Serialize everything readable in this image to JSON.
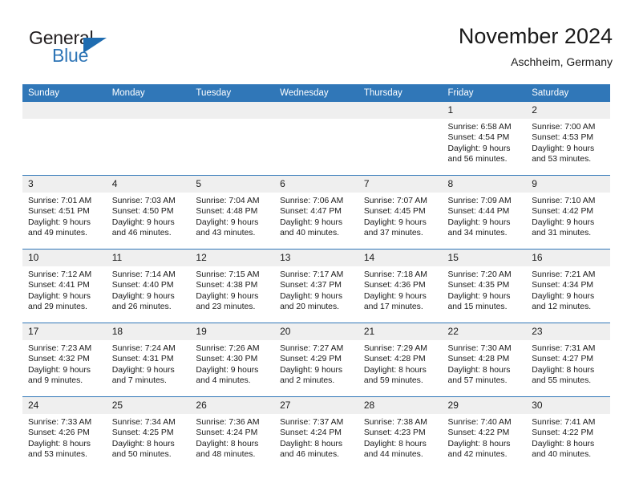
{
  "brand": {
    "name_part1": "General",
    "name_part2": "Blue",
    "flag_icon": "triangle-flag-icon"
  },
  "header": {
    "title": "November 2024",
    "location": "Aschheim, Germany"
  },
  "colors": {
    "header_blue": "#3077b8",
    "brand_blue": "#2e75b6",
    "daynum_band": "#efefef",
    "text": "#1a1a1a"
  },
  "calendar": {
    "weekdays": [
      "Sunday",
      "Monday",
      "Tuesday",
      "Wednesday",
      "Thursday",
      "Friday",
      "Saturday"
    ],
    "weeks": [
      [
        {
          "day": "",
          "sunrise": "",
          "sunset": "",
          "daylight1": "",
          "daylight2": ""
        },
        {
          "day": "",
          "sunrise": "",
          "sunset": "",
          "daylight1": "",
          "daylight2": ""
        },
        {
          "day": "",
          "sunrise": "",
          "sunset": "",
          "daylight1": "",
          "daylight2": ""
        },
        {
          "day": "",
          "sunrise": "",
          "sunset": "",
          "daylight1": "",
          "daylight2": ""
        },
        {
          "day": "",
          "sunrise": "",
          "sunset": "",
          "daylight1": "",
          "daylight2": ""
        },
        {
          "day": "1",
          "sunrise": "Sunrise: 6:58 AM",
          "sunset": "Sunset: 4:54 PM",
          "daylight1": "Daylight: 9 hours",
          "daylight2": "and 56 minutes."
        },
        {
          "day": "2",
          "sunrise": "Sunrise: 7:00 AM",
          "sunset": "Sunset: 4:53 PM",
          "daylight1": "Daylight: 9 hours",
          "daylight2": "and 53 minutes."
        }
      ],
      [
        {
          "day": "3",
          "sunrise": "Sunrise: 7:01 AM",
          "sunset": "Sunset: 4:51 PM",
          "daylight1": "Daylight: 9 hours",
          "daylight2": "and 49 minutes."
        },
        {
          "day": "4",
          "sunrise": "Sunrise: 7:03 AM",
          "sunset": "Sunset: 4:50 PM",
          "daylight1": "Daylight: 9 hours",
          "daylight2": "and 46 minutes."
        },
        {
          "day": "5",
          "sunrise": "Sunrise: 7:04 AM",
          "sunset": "Sunset: 4:48 PM",
          "daylight1": "Daylight: 9 hours",
          "daylight2": "and 43 minutes."
        },
        {
          "day": "6",
          "sunrise": "Sunrise: 7:06 AM",
          "sunset": "Sunset: 4:47 PM",
          "daylight1": "Daylight: 9 hours",
          "daylight2": "and 40 minutes."
        },
        {
          "day": "7",
          "sunrise": "Sunrise: 7:07 AM",
          "sunset": "Sunset: 4:45 PM",
          "daylight1": "Daylight: 9 hours",
          "daylight2": "and 37 minutes."
        },
        {
          "day": "8",
          "sunrise": "Sunrise: 7:09 AM",
          "sunset": "Sunset: 4:44 PM",
          "daylight1": "Daylight: 9 hours",
          "daylight2": "and 34 minutes."
        },
        {
          "day": "9",
          "sunrise": "Sunrise: 7:10 AM",
          "sunset": "Sunset: 4:42 PM",
          "daylight1": "Daylight: 9 hours",
          "daylight2": "and 31 minutes."
        }
      ],
      [
        {
          "day": "10",
          "sunrise": "Sunrise: 7:12 AM",
          "sunset": "Sunset: 4:41 PM",
          "daylight1": "Daylight: 9 hours",
          "daylight2": "and 29 minutes."
        },
        {
          "day": "11",
          "sunrise": "Sunrise: 7:14 AM",
          "sunset": "Sunset: 4:40 PM",
          "daylight1": "Daylight: 9 hours",
          "daylight2": "and 26 minutes."
        },
        {
          "day": "12",
          "sunrise": "Sunrise: 7:15 AM",
          "sunset": "Sunset: 4:38 PM",
          "daylight1": "Daylight: 9 hours",
          "daylight2": "and 23 minutes."
        },
        {
          "day": "13",
          "sunrise": "Sunrise: 7:17 AM",
          "sunset": "Sunset: 4:37 PM",
          "daylight1": "Daylight: 9 hours",
          "daylight2": "and 20 minutes."
        },
        {
          "day": "14",
          "sunrise": "Sunrise: 7:18 AM",
          "sunset": "Sunset: 4:36 PM",
          "daylight1": "Daylight: 9 hours",
          "daylight2": "and 17 minutes."
        },
        {
          "day": "15",
          "sunrise": "Sunrise: 7:20 AM",
          "sunset": "Sunset: 4:35 PM",
          "daylight1": "Daylight: 9 hours",
          "daylight2": "and 15 minutes."
        },
        {
          "day": "16",
          "sunrise": "Sunrise: 7:21 AM",
          "sunset": "Sunset: 4:34 PM",
          "daylight1": "Daylight: 9 hours",
          "daylight2": "and 12 minutes."
        }
      ],
      [
        {
          "day": "17",
          "sunrise": "Sunrise: 7:23 AM",
          "sunset": "Sunset: 4:32 PM",
          "daylight1": "Daylight: 9 hours",
          "daylight2": "and 9 minutes."
        },
        {
          "day": "18",
          "sunrise": "Sunrise: 7:24 AM",
          "sunset": "Sunset: 4:31 PM",
          "daylight1": "Daylight: 9 hours",
          "daylight2": "and 7 minutes."
        },
        {
          "day": "19",
          "sunrise": "Sunrise: 7:26 AM",
          "sunset": "Sunset: 4:30 PM",
          "daylight1": "Daylight: 9 hours",
          "daylight2": "and 4 minutes."
        },
        {
          "day": "20",
          "sunrise": "Sunrise: 7:27 AM",
          "sunset": "Sunset: 4:29 PM",
          "daylight1": "Daylight: 9 hours",
          "daylight2": "and 2 minutes."
        },
        {
          "day": "21",
          "sunrise": "Sunrise: 7:29 AM",
          "sunset": "Sunset: 4:28 PM",
          "daylight1": "Daylight: 8 hours",
          "daylight2": "and 59 minutes."
        },
        {
          "day": "22",
          "sunrise": "Sunrise: 7:30 AM",
          "sunset": "Sunset: 4:28 PM",
          "daylight1": "Daylight: 8 hours",
          "daylight2": "and 57 minutes."
        },
        {
          "day": "23",
          "sunrise": "Sunrise: 7:31 AM",
          "sunset": "Sunset: 4:27 PM",
          "daylight1": "Daylight: 8 hours",
          "daylight2": "and 55 minutes."
        }
      ],
      [
        {
          "day": "24",
          "sunrise": "Sunrise: 7:33 AM",
          "sunset": "Sunset: 4:26 PM",
          "daylight1": "Daylight: 8 hours",
          "daylight2": "and 53 minutes."
        },
        {
          "day": "25",
          "sunrise": "Sunrise: 7:34 AM",
          "sunset": "Sunset: 4:25 PM",
          "daylight1": "Daylight: 8 hours",
          "daylight2": "and 50 minutes."
        },
        {
          "day": "26",
          "sunrise": "Sunrise: 7:36 AM",
          "sunset": "Sunset: 4:24 PM",
          "daylight1": "Daylight: 8 hours",
          "daylight2": "and 48 minutes."
        },
        {
          "day": "27",
          "sunrise": "Sunrise: 7:37 AM",
          "sunset": "Sunset: 4:24 PM",
          "daylight1": "Daylight: 8 hours",
          "daylight2": "and 46 minutes."
        },
        {
          "day": "28",
          "sunrise": "Sunrise: 7:38 AM",
          "sunset": "Sunset: 4:23 PM",
          "daylight1": "Daylight: 8 hours",
          "daylight2": "and 44 minutes."
        },
        {
          "day": "29",
          "sunrise": "Sunrise: 7:40 AM",
          "sunset": "Sunset: 4:22 PM",
          "daylight1": "Daylight: 8 hours",
          "daylight2": "and 42 minutes."
        },
        {
          "day": "30",
          "sunrise": "Sunrise: 7:41 AM",
          "sunset": "Sunset: 4:22 PM",
          "daylight1": "Daylight: 8 hours",
          "daylight2": "and 40 minutes."
        }
      ]
    ]
  }
}
